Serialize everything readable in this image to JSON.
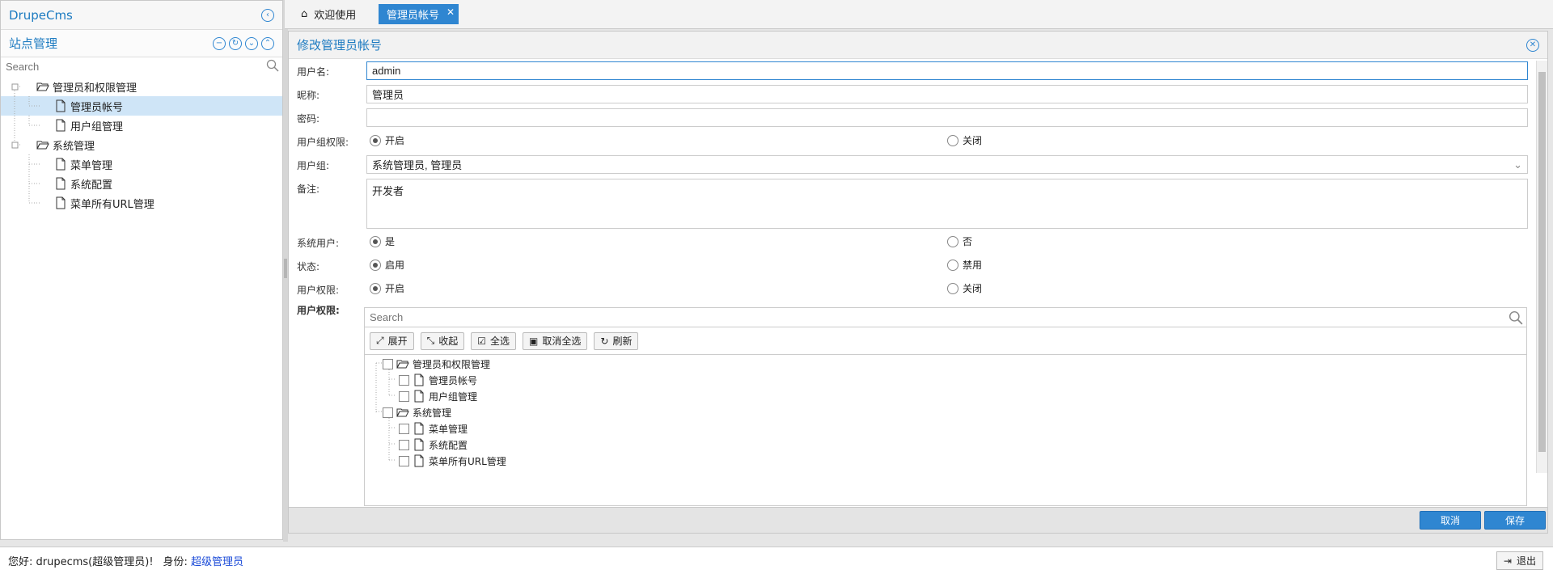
{
  "app": {
    "title": "DrupeCms"
  },
  "sidebar": {
    "panel_title": "站点管理",
    "search_placeholder": "Search",
    "tree": [
      {
        "label": "管理员和权限管理",
        "type": "folder",
        "depth": 0
      },
      {
        "label": "管理员帐号",
        "type": "file",
        "depth": 1,
        "selected": true
      },
      {
        "label": "用户组管理",
        "type": "file",
        "depth": 1
      },
      {
        "label": "系统管理",
        "type": "folder",
        "depth": 0
      },
      {
        "label": "菜单管理",
        "type": "file",
        "depth": 1
      },
      {
        "label": "系统配置",
        "type": "file",
        "depth": 1
      },
      {
        "label": "菜单所有URL管理",
        "type": "file",
        "depth": 1
      }
    ]
  },
  "tabs": [
    {
      "label": "欢迎使用",
      "icon": "home-icon"
    },
    {
      "label": "管理员帐号",
      "icon": "close-icon"
    }
  ],
  "form": {
    "title": "修改管理员帐号",
    "fields": {
      "username": {
        "label": "用户名:",
        "value": "admin"
      },
      "nickname": {
        "label": "昵称:",
        "value": "管理员"
      },
      "password": {
        "label": "密码:",
        "value": ""
      },
      "group_perm": {
        "label": "用户组权限:",
        "on": "开启",
        "off": "关闭",
        "selected": "开启"
      },
      "group": {
        "label": "用户组:",
        "value": "系统管理员, 管理员"
      },
      "remark": {
        "label": "备注:",
        "value": "开发者"
      },
      "system_user": {
        "label": "系统用户:",
        "on": "是",
        "off": "否",
        "selected": "是"
      },
      "status": {
        "label": "状态:",
        "on": "启用",
        "off": "禁用",
        "selected": "启用"
      },
      "user_perm_toggle": {
        "label": "用户权限:",
        "on": "开启",
        "off": "关闭",
        "selected": "开启"
      },
      "user_perm_tree_label": "用户权限:"
    },
    "perm_search_placeholder": "Search",
    "toolbar": {
      "expand": "展开",
      "collapse": "收起",
      "select_all": "全选",
      "deselect_all": "取消全选",
      "refresh": "刷新"
    },
    "perm_tree": [
      {
        "label": "管理员和权限管理",
        "type": "folder",
        "depth": 0
      },
      {
        "label": "管理员帐号",
        "type": "file",
        "depth": 1
      },
      {
        "label": "用户组管理",
        "type": "file",
        "depth": 1
      },
      {
        "label": "系统管理",
        "type": "folder",
        "depth": 0
      },
      {
        "label": "菜单管理",
        "type": "file",
        "depth": 1
      },
      {
        "label": "系统配置",
        "type": "file",
        "depth": 1
      },
      {
        "label": "菜单所有URL管理",
        "type": "file",
        "depth": 1
      }
    ],
    "cancel": "取消",
    "save": "保存"
  },
  "status": {
    "greeting": "您好: drupecms(超级管理员)!",
    "identity_label": "身份:",
    "identity_value": "超级管理员",
    "logout": "退出"
  },
  "colors": {
    "accent": "#2f86d1",
    "selected_row": "#cfe5f7"
  }
}
